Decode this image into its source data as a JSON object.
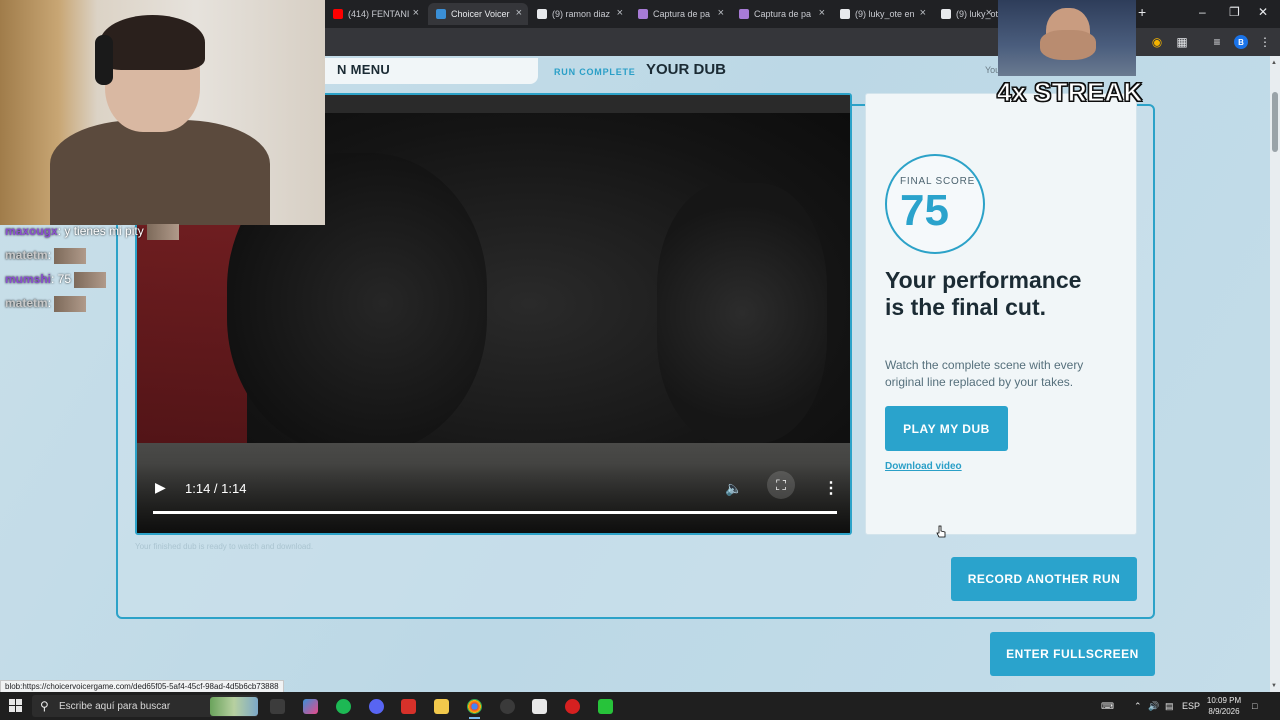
{
  "browser": {
    "tabs": [
      {
        "label": "(414) FENTANI",
        "color": "#ff0000"
      },
      {
        "label": "Choicer Voicer",
        "color": "#3a8fd6",
        "active": true
      },
      {
        "label": "(9) ramon diaz",
        "color": "#e8eaed"
      },
      {
        "label": "Captura de pa",
        "color": "#a77bd6"
      },
      {
        "label": "Captura de pa",
        "color": "#a77bd6"
      },
      {
        "label": "(9) luky_ote en",
        "color": "#e8eaed"
      },
      {
        "label": "(9) luky_ote",
        "color": "#e8eaed"
      }
    ],
    "close_glyph": "×",
    "new_tab_glyph": "+",
    "profile_initial": "B",
    "status_url": "blob:https://choicervoicergame.com/ded65f05-5af4-45cf-98ad-4d5b6cb73888"
  },
  "game": {
    "menu_label": "N MENU",
    "run_complete": "RUN COMPLETE",
    "your_dub": "YOUR DUB",
    "you_hint": "You",
    "video": {
      "time": "1:14 / 1:14",
      "progress": 1.0
    },
    "caption_under_video": "Your finished dub is ready to watch and download.",
    "score": {
      "label": "FINAL SCORE",
      "value": "75"
    },
    "headline": "Your performance is the final cut.",
    "description": "Watch the complete scene with every original line replaced by your takes.",
    "play_dub_label": "PLAY MY DUB",
    "download_label": "Download video",
    "record_another_label": "RECORD ANOTHER RUN",
    "enter_fullscreen_label": "ENTER FULLSCREEN",
    "accent_color": "#2aa3cc"
  },
  "stream_overlay": {
    "chat": [
      {
        "user": "maxougx",
        "text": ": y tienes mi pity",
        "user_color": "#8a4fd0"
      },
      {
        "user": "matetm",
        "text": ":",
        "user_color": "#c9c9c9"
      },
      {
        "user": "mumshi",
        "text": ": 75",
        "user_color": "#8a4fd0"
      },
      {
        "user": "matetm",
        "text": ":",
        "user_color": "#c9c9c9"
      }
    ],
    "streak": "4x STREAK"
  },
  "taskbar": {
    "search_placeholder": "Escribe aquí para buscar",
    "language": "ESP",
    "time": "10:09 PM",
    "date": "8/9/2026"
  }
}
